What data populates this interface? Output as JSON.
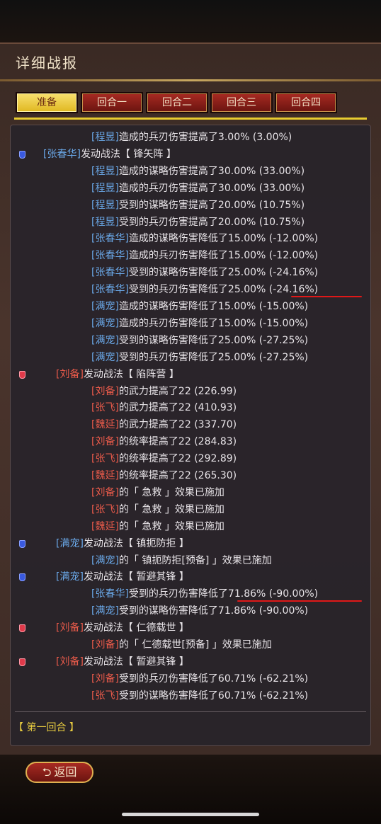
{
  "header": {
    "title": "详细战报"
  },
  "tabs": [
    {
      "label": "准备",
      "active": true
    },
    {
      "label": "回合一",
      "active": false
    },
    {
      "label": "回合二",
      "active": false
    },
    {
      "label": "回合三",
      "active": false
    },
    {
      "label": "回合四",
      "active": false
    }
  ],
  "log": [
    {
      "marker": "",
      "indent": 2,
      "name": "[程昱]",
      "nameColor": "blue",
      "text": "造成的兵刃伤害提高了3.00% (3.00%)"
    },
    {
      "marker": "blue",
      "indent": 1,
      "name": "[张春华]",
      "nameColor": "blue",
      "text": "发动战法【 锋矢阵 】"
    },
    {
      "marker": "",
      "indent": 2,
      "name": "[程昱]",
      "nameColor": "blue",
      "text": "造成的谋略伤害提高了30.00% (33.00%)"
    },
    {
      "marker": "",
      "indent": 2,
      "name": "[程昱]",
      "nameColor": "blue",
      "text": "造成的兵刃伤害提高了30.00% (33.00%)"
    },
    {
      "marker": "",
      "indent": 2,
      "name": "[程昱]",
      "nameColor": "blue",
      "text": "受到的谋略伤害提高了20.00% (10.75%)"
    },
    {
      "marker": "",
      "indent": 2,
      "name": "[程昱]",
      "nameColor": "blue",
      "text": "受到的兵刃伤害提高了20.00% (10.75%)"
    },
    {
      "marker": "",
      "indent": 2,
      "name": "[张春华]",
      "nameColor": "blue",
      "text": "造成的谋略伤害降低了15.00% (-12.00%)"
    },
    {
      "marker": "",
      "indent": 2,
      "name": "[张春华]",
      "nameColor": "blue",
      "text": "造成的兵刃伤害降低了15.00% (-12.00%)"
    },
    {
      "marker": "",
      "indent": 2,
      "name": "[张春华]",
      "nameColor": "blue",
      "text": "受到的谋略伤害降低了25.00% (-24.16%)"
    },
    {
      "marker": "",
      "indent": 2,
      "name": "[张春华]",
      "nameColor": "blue",
      "text": "受到的兵刃伤害降低了25.00% (-24.16%)"
    },
    {
      "marker": "",
      "indent": 2,
      "name": "[满宠]",
      "nameColor": "blue",
      "text": "造成的谋略伤害降低了15.00% (-15.00%)"
    },
    {
      "marker": "",
      "indent": 2,
      "name": "[满宠]",
      "nameColor": "blue",
      "text": "造成的兵刃伤害降低了15.00% (-15.00%)"
    },
    {
      "marker": "",
      "indent": 2,
      "name": "[满宠]",
      "nameColor": "blue",
      "text": "受到的谋略伤害降低了25.00% (-27.25%)"
    },
    {
      "marker": "",
      "indent": 2,
      "name": "[满宠]",
      "nameColor": "blue",
      "text": "受到的兵刃伤害降低了25.00% (-27.25%)"
    },
    {
      "marker": "red",
      "indent": 1.5,
      "name": "[刘备]",
      "nameColor": "red",
      "text": "发动战法【 陷阵营 】"
    },
    {
      "marker": "",
      "indent": 2,
      "name": "[刘备]",
      "nameColor": "red",
      "text": "的武力提高了22 (226.99)"
    },
    {
      "marker": "",
      "indent": 2,
      "name": "[张飞]",
      "nameColor": "red",
      "text": "的武力提高了22 (410.93)"
    },
    {
      "marker": "",
      "indent": 2,
      "name": "[魏延]",
      "nameColor": "red",
      "text": "的武力提高了22 (337.70)"
    },
    {
      "marker": "",
      "indent": 2,
      "name": "[刘备]",
      "nameColor": "red",
      "text": "的统率提高了22 (284.83)"
    },
    {
      "marker": "",
      "indent": 2,
      "name": "[张飞]",
      "nameColor": "red",
      "text": "的统率提高了22 (292.89)"
    },
    {
      "marker": "",
      "indent": 2,
      "name": "[魏延]",
      "nameColor": "red",
      "text": "的统率提高了22 (265.30)"
    },
    {
      "marker": "",
      "indent": 2,
      "name": "[刘备]",
      "nameColor": "red",
      "text": "的「 急救 」效果已施加"
    },
    {
      "marker": "",
      "indent": 2,
      "name": "[张飞]",
      "nameColor": "red",
      "text": "的「 急救 」效果已施加"
    },
    {
      "marker": "",
      "indent": 2,
      "name": "[魏延]",
      "nameColor": "red",
      "text": "的「 急救 」效果已施加"
    },
    {
      "marker": "blue",
      "indent": 1.5,
      "name": "[满宠]",
      "nameColor": "blue",
      "text": "发动战法【 镇扼防拒 】"
    },
    {
      "marker": "",
      "indent": 2,
      "name": "[满宠]",
      "nameColor": "blue",
      "text": "的「 镇扼防拒[预备] 」效果已施加"
    },
    {
      "marker": "blue",
      "indent": 1.5,
      "name": "[满宠]",
      "nameColor": "blue",
      "text": "发动战法【 暂避其锋 】"
    },
    {
      "marker": "",
      "indent": 2,
      "name": "[张春华]",
      "nameColor": "blue",
      "text": "受到的兵刃伤害降低了71.86% (-90.00%)"
    },
    {
      "marker": "",
      "indent": 2,
      "name": "[满宠]",
      "nameColor": "blue",
      "text": "受到的谋略伤害降低了71.86% (-90.00%)"
    },
    {
      "marker": "red",
      "indent": 1.5,
      "name": "[刘备]",
      "nameColor": "red",
      "text": "发动战法【 仁德载世 】"
    },
    {
      "marker": "",
      "indent": 2,
      "name": "[刘备]",
      "nameColor": "red",
      "text": "的「 仁德载世[预备] 」效果已施加"
    },
    {
      "marker": "red",
      "indent": 1.5,
      "name": "[刘备]",
      "nameColor": "red",
      "text": "发动战法【 暂避其锋 】"
    },
    {
      "marker": "",
      "indent": 2,
      "name": "[刘备]",
      "nameColor": "red",
      "text": "受到的兵刃伤害降低了60.71% (-62.21%)"
    },
    {
      "marker": "",
      "indent": 2,
      "name": "[张飞]",
      "nameColor": "red",
      "text": "受到的谋略伤害降低了60.71% (-62.21%)"
    }
  ],
  "round_label": "【 第一回合 】",
  "footer": {
    "back_label": "返回",
    "back_icon": "return-arrow-icon"
  },
  "colors": {
    "blue_name": "#6aa8e8",
    "red_name": "#e85a4a",
    "highlight": "#e01818",
    "tab_active": "#f0cc40",
    "tab": "#8a1a14"
  }
}
